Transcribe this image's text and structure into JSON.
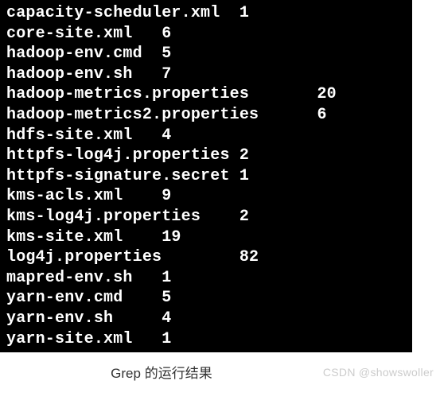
{
  "terminal": {
    "lines": [
      "capacity-scheduler.xml  1",
      "core-site.xml   6",
      "hadoop-env.cmd  5",
      "hadoop-env.sh   7",
      "hadoop-metrics.properties       20",
      "hadoop-metrics2.properties      6",
      "hdfs-site.xml   4",
      "httpfs-log4j.properties 2",
      "httpfs-signature.secret 1",
      "kms-acls.xml    9",
      "kms-log4j.properties    2",
      "kms-site.xml    19",
      "log4j.properties        82",
      "mapred-env.sh   1",
      "yarn-env.cmd    5",
      "yarn-env.sh     4",
      "yarn-site.xml   1"
    ]
  },
  "caption": "Grep 的运行结果",
  "watermark": "CSDN @showswoller"
}
